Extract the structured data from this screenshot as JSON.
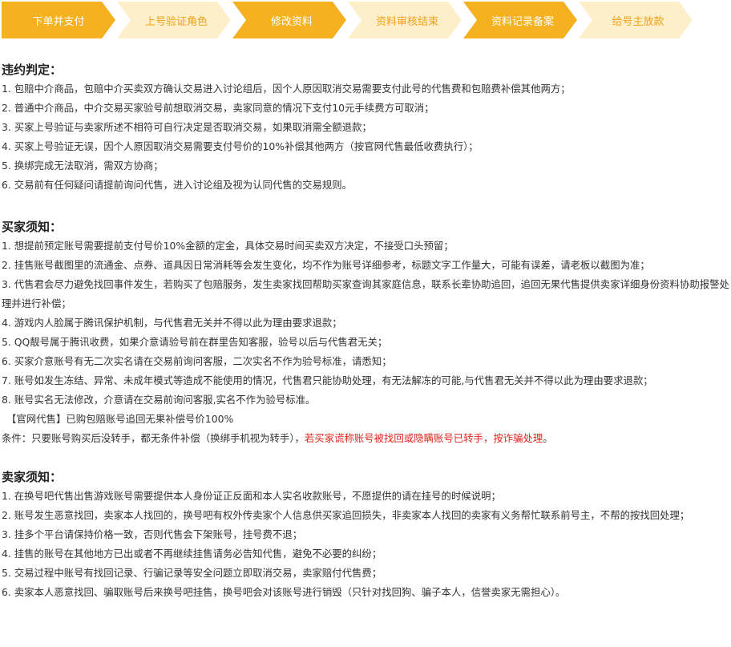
{
  "steps": [
    {
      "label": "下单并支付",
      "active": true
    },
    {
      "label": "上号验证角色",
      "active": false
    },
    {
      "label": "修改资料",
      "active": true
    },
    {
      "label": "资料审核结束",
      "active": false
    },
    {
      "label": "资料记录备案",
      "active": true
    },
    {
      "label": "给号主放款",
      "active": false
    }
  ],
  "violation": {
    "title": "违约判定：",
    "items": [
      "1. 包赔中介商品，包赔中介买卖双方确认交易进入讨论组后，因个人原因取消交易需要支付此号的代售费和包赔费补偿其他两方；",
      "2. 普通中介商品，中介交易买家验号前想取消交易，卖家同意的情况下支付10元手续费方可取消；",
      "3. 买家上号验证与卖家所述不相符可自行决定是否取消交易，如果取消需全额退款；",
      "4. 买家上号验证无误，因个人原因取消交易需要支付号价的10%补偿其他两方（按官网代售最低收费执行）；",
      "5. 换绑完成无法取消，需双方协商；",
      "6. 交易前有任何疑问请提前询问代售，进入讨论组及视为认同代售的交易规则。"
    ]
  },
  "buyer": {
    "title": "买家须知：",
    "items": [
      "1. 想提前预定账号需要提前支付号价10%金额的定金，具体交易时间买卖双方决定，不接受口头预留；",
      "2. 挂售账号截图里的流通金、点券、道具因日常消耗等会发生变化，均不作为账号详细参考，标题文字工作量大，可能有误差，请老板以截图为准；",
      "3. 代售君会尽力避免找回事件发生，若购买了包赔服务，发生卖家找回帮助买家查询其家庭信息，联系长辈协助追回，追回无果代售提供卖家详细身份资料协助报警处理并进行补偿；",
      "4. 游戏内人脸属于腾讯保护机制，与代售君无关并不得以此为理由要求退款；",
      "5. QQ靓号属于腾讯收费，如果介意请验号前在群里告知客服，验号以后与代售君无关；",
      "6. 买家介意账号有无二次实名请在交易前询问客服，二次实名不作为验号标准，请悉知；",
      "7. 账号如发生冻结、异常、未成年模式等造成不能使用的情况，代售君只能协助处理，有无法解冻的可能,与代售君无关并不得以此为理由要求退款；",
      "8. 账号实名无法修改，介意请在交易前询问客服,实名不作为验号标准。"
    ],
    "highlight": "【官网代售】已购包赔账号追回无果补偿号价100%",
    "condition_prefix": "条件：只要账号购买后没转手，都无条件补偿（换绑手机视为转手），",
    "condition_red": "若买家谎称账号被找回或隐瞒账号已转手，按诈骗处理",
    "condition_suffix": "。"
  },
  "seller": {
    "title": "卖家须知：",
    "items": [
      "1. 在换号吧代售出售游戏账号需要提供本人身份证正反面和本人实名收款账号，不愿提供的请在挂号的时候说明；",
      "2. 账号发生恶意找回，卖家本人找回的，换号吧有权外传卖家个人信息供买家追回损失，非卖家本人找回的卖家有义务帮忙联系前号主，不帮的按找回处理；",
      "3. 挂多个平台请保持价格一致，否则代售会下架账号，挂号费不退；",
      "4. 挂售的账号在其他地方已出或者不再继续挂售请务必告知代售，避免不必要的纠纷；",
      "5. 交易过程中账号有找回记录、行骗记录等安全问题立即取消交易，卖家赔付代售费；",
      "6. 卖家本人恶意找回、骗取账号后来换号吧挂售，换号吧会对该账号进行销毁（只针对找回狗、骗子本人，信誉卖家无需担心）。"
    ]
  }
}
